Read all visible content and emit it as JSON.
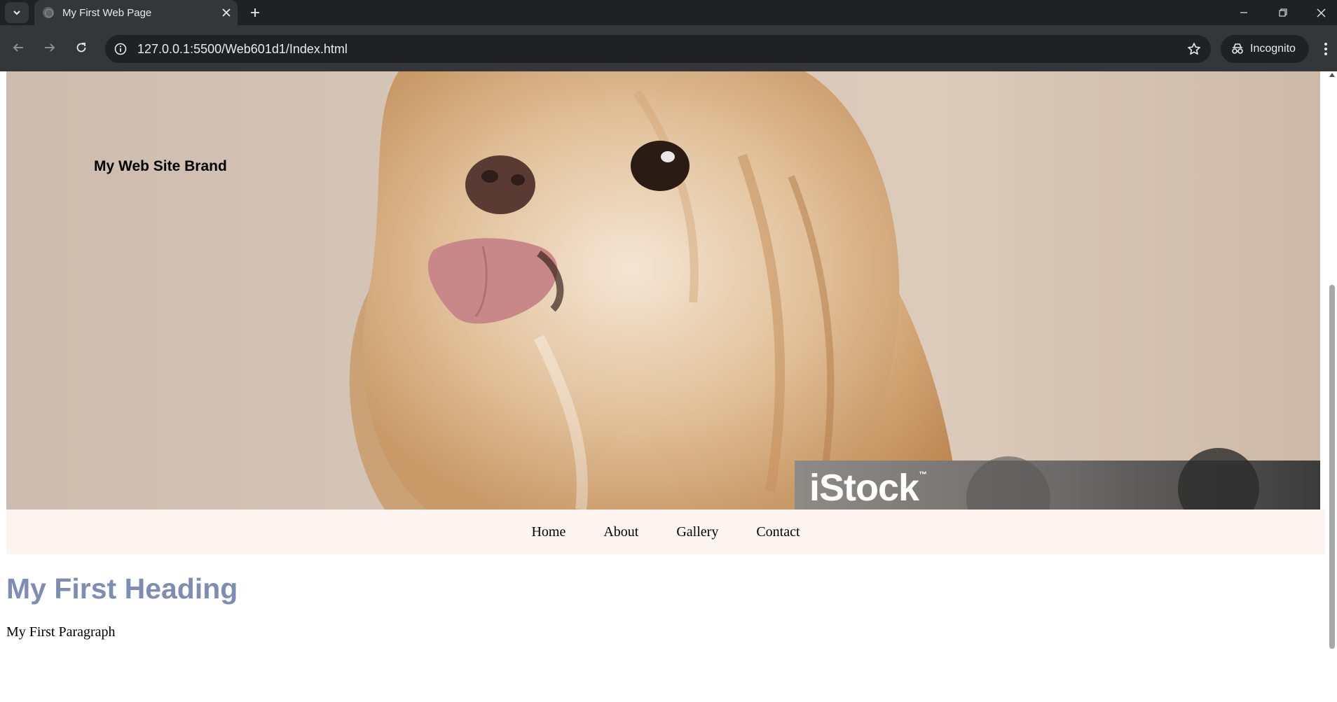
{
  "browser": {
    "tab_title": "My First Web Page",
    "url": "127.0.0.1:5500/Web601d1/Index.html",
    "profile_label": "Incognito",
    "icons": [
      "tab-search-icon",
      "globe-icon",
      "close-icon",
      "plus-icon",
      "minimize-icon",
      "restore-icon",
      "window-close-icon",
      "back-arrow-icon",
      "forward-arrow-icon",
      "reload-icon",
      "info-icon",
      "star-icon",
      "incognito-icon",
      "more-vert-icon"
    ]
  },
  "page": {
    "brand": "My Web Site Brand",
    "hero_watermark": "iStock",
    "hero_watermark_tm": "™",
    "nav": [
      {
        "label": "Home"
      },
      {
        "label": "About"
      },
      {
        "label": "Gallery"
      },
      {
        "label": "Contact"
      }
    ],
    "heading": "My First Heading",
    "paragraph": "My First Paragraph"
  },
  "colors": {
    "chrome_dark": "#202124",
    "chrome_toolbar": "#35363a",
    "nav_background": "#fdf3ef",
    "heading_color": "#7d8db3"
  }
}
